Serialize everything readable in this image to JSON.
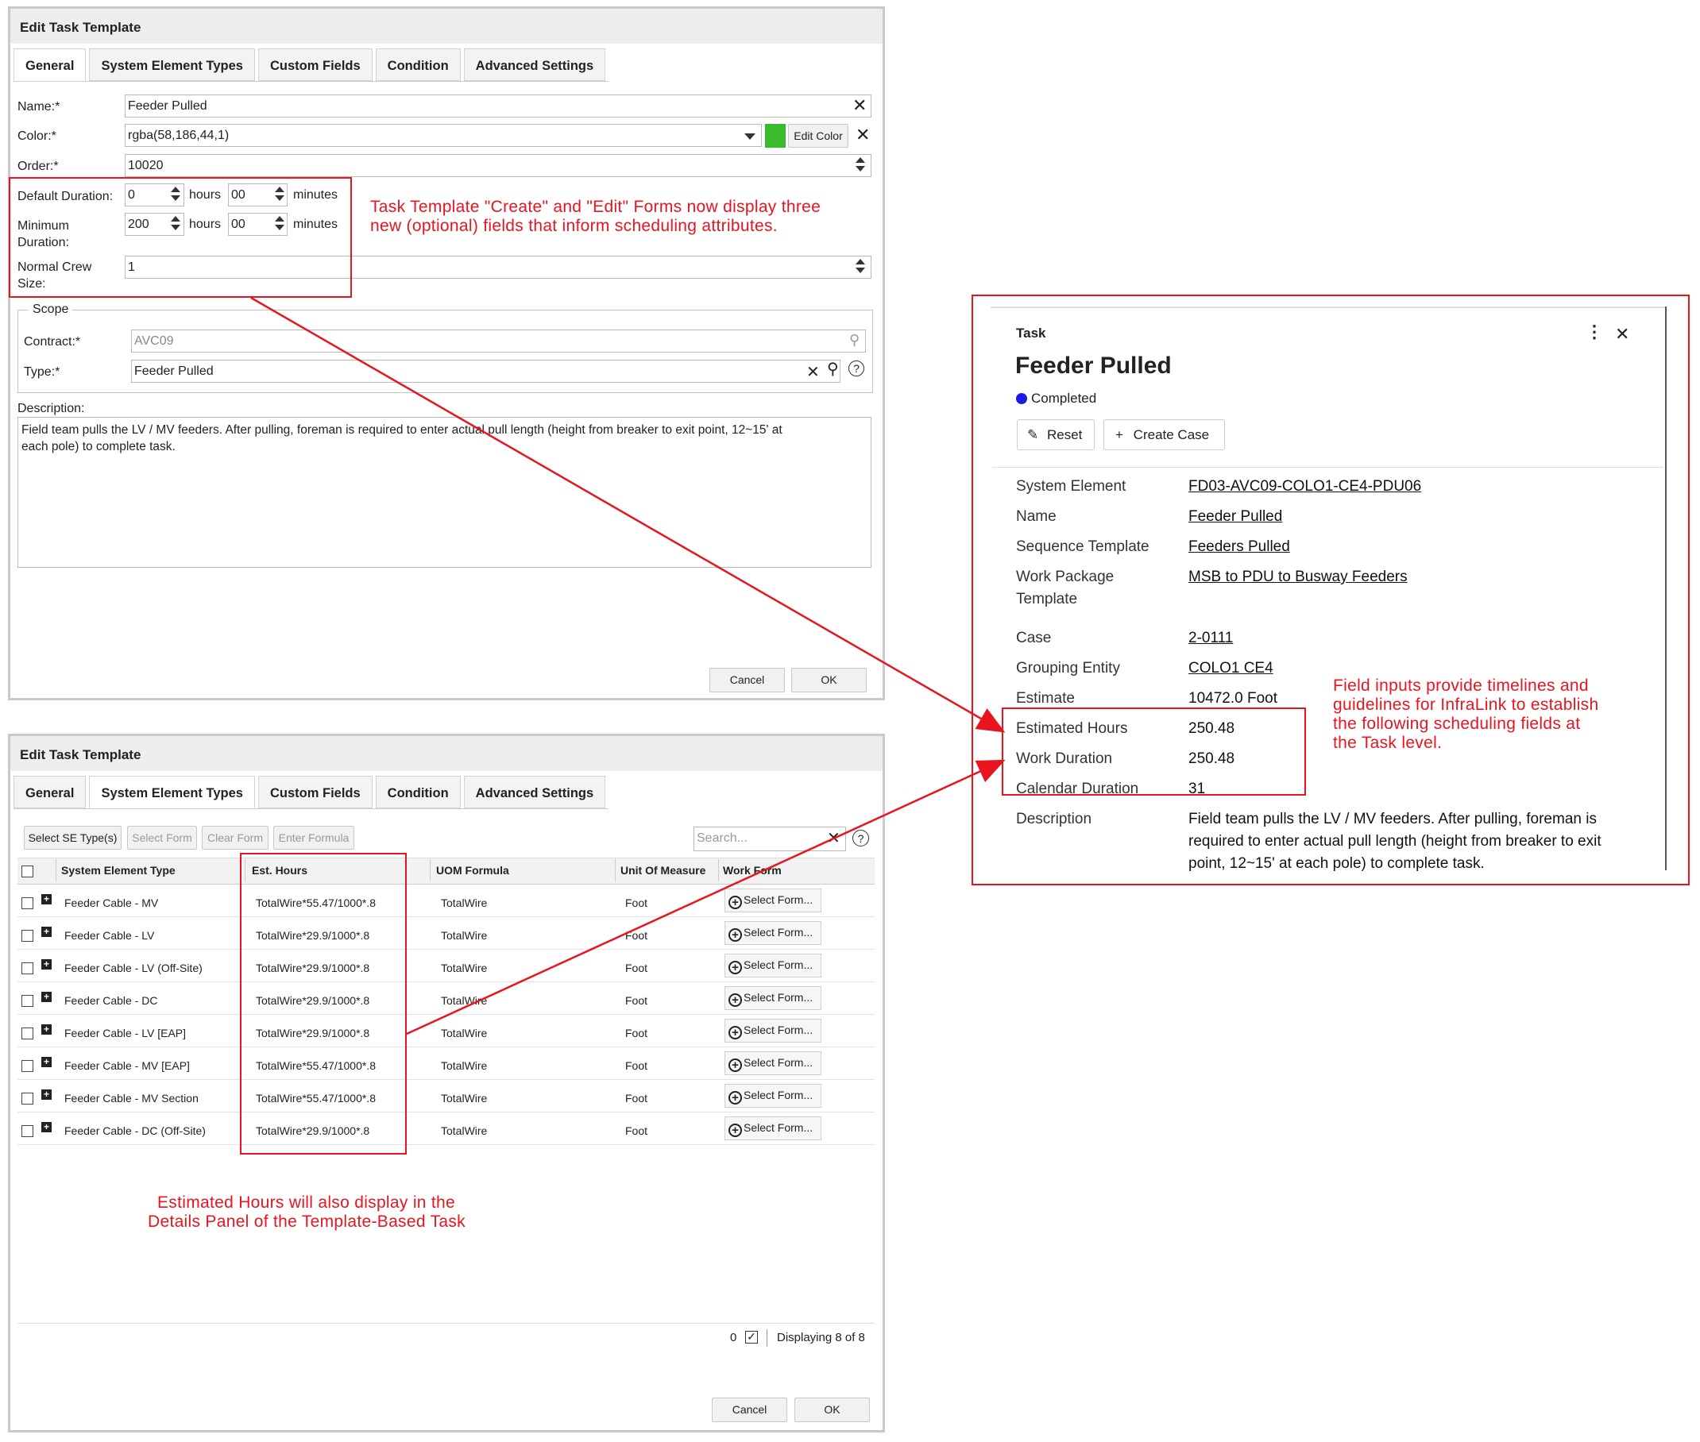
{
  "dialog1": {
    "title": "Edit Task Template",
    "tabs": [
      "General",
      "System Element Types",
      "Custom Fields",
      "Condition",
      "Advanced Settings"
    ],
    "name_label": "Name:*",
    "name_value": "Feeder Pulled",
    "color_label": "Color:*",
    "color_value": "rgba(58,186,44,1)",
    "color_swatch": "#3aba2c",
    "edit_color_label": "Edit Color",
    "order_label": "Order:*",
    "order_value": "10020",
    "default_duration_label": "Default Duration:",
    "default_hours": "0",
    "default_minutes": "00",
    "hours_unit": "hours",
    "minutes_unit": "minutes",
    "minimum_duration_label_1": "Minimum",
    "minimum_duration_label_2": "Duration:",
    "minimum_hours": "200",
    "minimum_minutes": "00",
    "crew_label_1": "Normal Crew",
    "crew_label_2": "Size:",
    "crew_value": "1",
    "scope_legend": "Scope",
    "contract_label": "Contract:*",
    "contract_value": "AVC09",
    "type_label": "Type:*",
    "type_value": "Feeder Pulled",
    "description_label": "Description:",
    "description_line1": "Field team pulls the LV / MV feeders. After pulling, foreman is required to enter actual pull length (height from breaker to exit point, 12~15' at",
    "description_line2": "each pole) to complete task.",
    "cancel_label": "Cancel",
    "ok_label": "OK"
  },
  "dialog2": {
    "title": "Edit Task Template",
    "tabs": [
      "General",
      "System Element Types",
      "Custom Fields",
      "Condition",
      "Advanced Settings"
    ],
    "toolbar": {
      "select_se": "Select SE Type(s)",
      "select_form": "Select Form",
      "clear_form": "Clear Form",
      "enter_formula": "Enter Formula",
      "search_placeholder": "Search..."
    },
    "columns": [
      "System Element Type",
      "Est. Hours",
      "UOM Formula",
      "Unit Of Measure",
      "Work Form"
    ],
    "rows": [
      {
        "type": "Feeder Cable - MV",
        "est": "TotalWire*55.47/1000*.8",
        "uom": "TotalWire",
        "unit": "Foot",
        "form": "Select Form..."
      },
      {
        "type": "Feeder Cable - LV",
        "est": "TotalWire*29.9/1000*.8",
        "uom": "TotalWire",
        "unit": "Foot",
        "form": "Select Form..."
      },
      {
        "type": "Feeder Cable - LV (Off-Site)",
        "est": "TotalWire*29.9/1000*.8",
        "uom": "TotalWire",
        "unit": "Foot",
        "form": "Select Form..."
      },
      {
        "type": "Feeder Cable - DC",
        "est": "TotalWire*29.9/1000*.8",
        "uom": "TotalWire",
        "unit": "Foot",
        "form": "Select Form..."
      },
      {
        "type": "Feeder Cable - LV [EAP]",
        "est": "TotalWire*29.9/1000*.8",
        "uom": "TotalWire",
        "unit": "Foot",
        "form": "Select Form..."
      },
      {
        "type": "Feeder Cable - MV [EAP]",
        "est": "TotalWire*55.47/1000*.8",
        "uom": "TotalWire",
        "unit": "Foot",
        "form": "Select Form..."
      },
      {
        "type": "Feeder Cable - MV Section",
        "est": "TotalWire*55.47/1000*.8",
        "uom": "TotalWire",
        "unit": "Foot",
        "form": "Select Form..."
      },
      {
        "type": "Feeder Cable - DC (Off-Site)",
        "est": "TotalWire*29.9/1000*.8",
        "uom": "TotalWire",
        "unit": "Foot",
        "form": "Select Form..."
      }
    ],
    "selected_count": "0",
    "displaying": "Displaying 8 of 8",
    "cancel_label": "Cancel",
    "ok_label": "OK"
  },
  "panel": {
    "kicker": "Task",
    "title": "Feeder Pulled",
    "status": "Completed",
    "status_color": "#1a1ae6",
    "reset_label": "Reset",
    "create_case_label": "Create Case",
    "fields": [
      {
        "label": "System Element",
        "value": "FD03-AVC09-COLO1-CE4-PDU06"
      },
      {
        "label": "Name",
        "value": "Feeder Pulled"
      },
      {
        "label": "Sequence Template",
        "value": "Feeders Pulled"
      },
      {
        "label": "Work Package",
        "label2": "Template",
        "value": "MSB to PDU to Busway Feeders"
      },
      {
        "label": "Case",
        "value": "2-0111"
      },
      {
        "label": "Grouping Entity",
        "value": "COLO1 CE4"
      },
      {
        "label": "Estimate",
        "value": "10472.0 Foot"
      },
      {
        "label": "Estimated Hours",
        "value": "250.48"
      },
      {
        "label": "Work Duration",
        "value": "250.48"
      },
      {
        "label": "Calendar Duration",
        "value": "31"
      },
      {
        "label": "Description",
        "value_lines": [
          "Field team pulls the LV / MV feeders. After pulling, foreman is",
          "required to enter actual pull length (height from breaker to exit",
          "point, 12~15' at each pole) to complete task."
        ]
      }
    ]
  },
  "annotations": {
    "note1_line1": "Task Template \"Create\" and \"Edit\" Forms now display three",
    "note1_line2": "new (optional) fields that inform scheduling attributes.",
    "note2_line1": "Field inputs provide timelines and",
    "note2_line2": "guidelines for InfraLink to establish",
    "note2_line3": "the following scheduling fields at",
    "note2_line4": "the Task level.",
    "note3_line1": "Estimated Hours will also display in the",
    "note3_line2": "Details Panel of the Template-Based Task",
    "accent_color": "#e8141e"
  }
}
